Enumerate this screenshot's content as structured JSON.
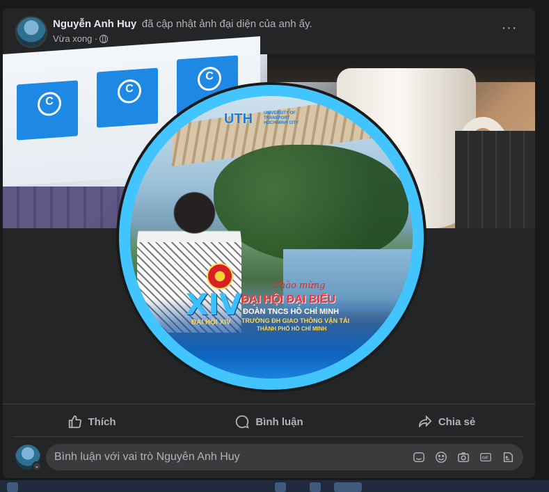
{
  "post": {
    "author": "Nguyễn Anh Huy",
    "action": "đã cập nhật ảnh đại diện của anh ấy.",
    "timestamp": "Vừa xong ·",
    "privacy_icon": "globe-icon",
    "more_icon": "···"
  },
  "profile_image": {
    "logo": "UTH",
    "logo_sub": "UNIVERSITY OF TRANSPORT HOCHIMINH CITY",
    "event_script": "Chào mừng",
    "event_title": "ĐẠI HỘI ĐẠI BIỂU",
    "event_line1": "ĐOÀN TNCS HỒ CHÍ MINH",
    "event_line2": "TRƯỜNG ĐH GIAO THÔNG VẬN TẢI",
    "event_line3": "THÀNH PHỐ HỒ CHÍ MINH",
    "congress_mark": "XIV",
    "congress_label": "ĐẠI HỘI XIV"
  },
  "actions": {
    "like": "Thích",
    "comment": "Bình luận",
    "share": "Chia sẻ"
  },
  "comment": {
    "placeholder": "Bình luận với vai trò Nguyễn Anh Huy",
    "tools": [
      "sticker-icon",
      "emoji-icon",
      "camera-icon",
      "gif-icon",
      "avatar-sticker-icon"
    ]
  },
  "colors": {
    "card_bg": "#242526",
    "page_bg": "#18191a",
    "text_primary": "#e4e6eb",
    "text_secondary": "#b0b3b8"
  }
}
